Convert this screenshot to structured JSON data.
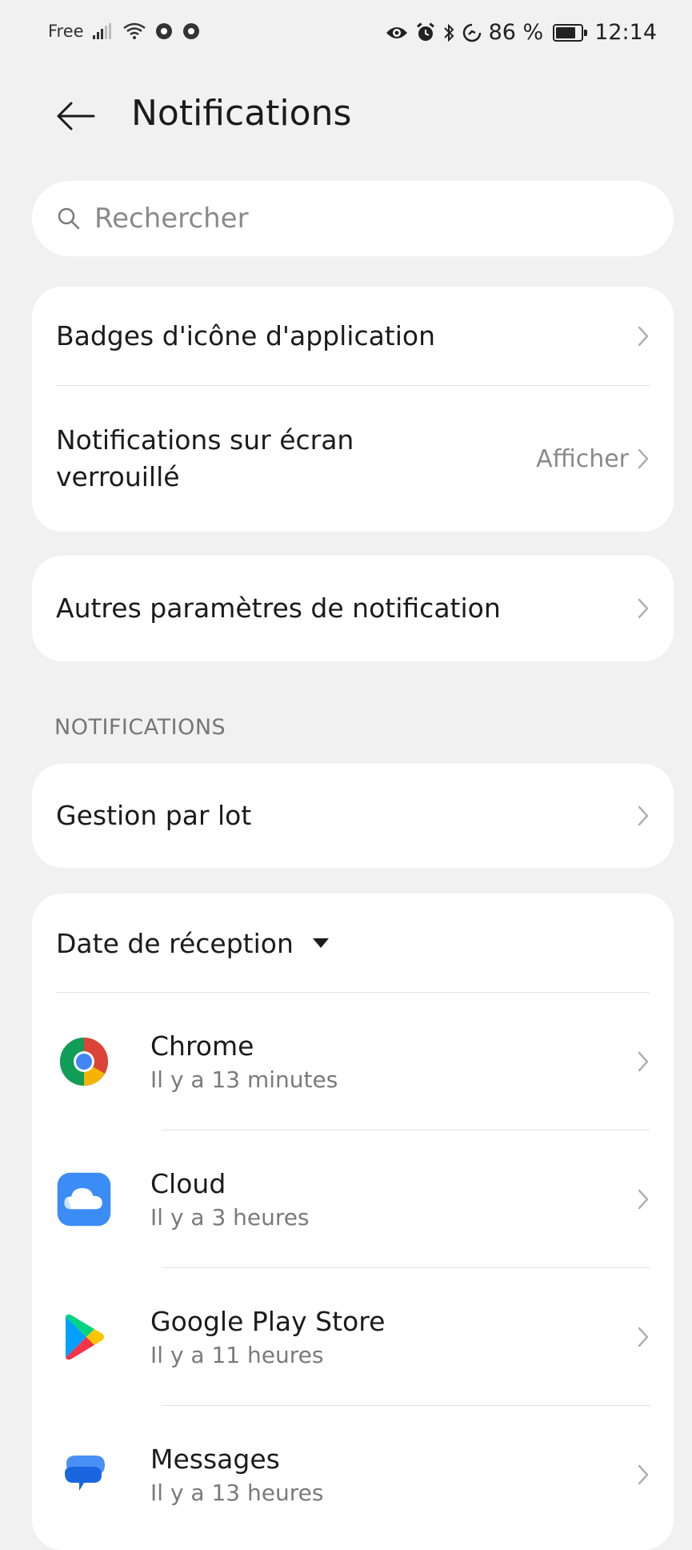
{
  "status_bar": {
    "carrier": "Free",
    "battery_percent": "86 %",
    "time": "12:14",
    "battery_level": 0.86
  },
  "header": {
    "title": "Notifications"
  },
  "search": {
    "placeholder": "Rechercher"
  },
  "settings": {
    "badges_label": "Badges d'icône d'application",
    "lock_screen_label_line1": "Notifications sur écran",
    "lock_screen_label_line2": "verrouillé",
    "lock_screen_value": "Afficher",
    "other_settings_label": "Autres paramètres de notification"
  },
  "notifications_section": {
    "title": "NOTIFICATIONS",
    "batch_label": "Gestion par lot",
    "sort_label": "Date de réception"
  },
  "apps": [
    {
      "name": "Chrome",
      "time": "Il y a 13 minutes",
      "icon": "chrome-icon"
    },
    {
      "name": "Cloud",
      "time": "Il y a 3 heures",
      "icon": "cloud-icon"
    },
    {
      "name": "Google Play Store",
      "time": "Il y a 11 heures",
      "icon": "play-store-icon"
    },
    {
      "name": "Messages",
      "time": "Il y a 13 heures",
      "icon": "messages-icon"
    }
  ],
  "colors": {
    "background": "#f1f1f1",
    "card": "#ffffff",
    "secondary_text": "#8a8a8a",
    "cloud_blue": "#3b8cf5"
  }
}
